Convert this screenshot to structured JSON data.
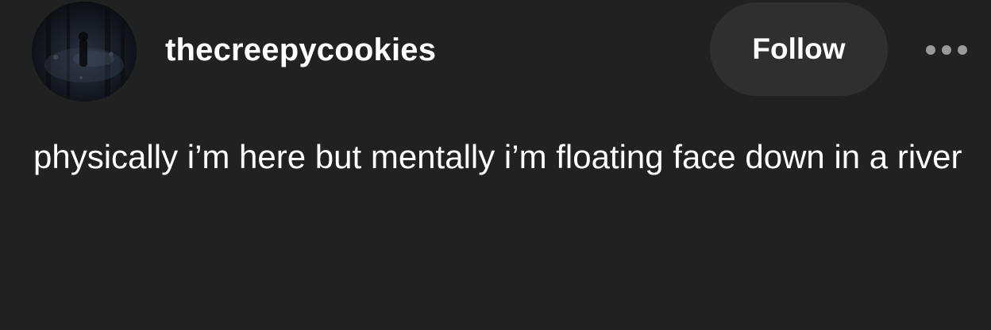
{
  "post": {
    "author": {
      "username": "thecreepycookies",
      "avatar_icon": "dark-forest-avatar"
    },
    "actions": {
      "follow_label": "Follow",
      "more_icon": "more-options-icon"
    },
    "body": {
      "text": "physically i’m here but mentally i’m floating face down in a river"
    }
  },
  "colors": {
    "background": "#212121",
    "button_background": "#2f2f2f",
    "text": "#ffffff",
    "more_dots": "#9a9a9a"
  }
}
